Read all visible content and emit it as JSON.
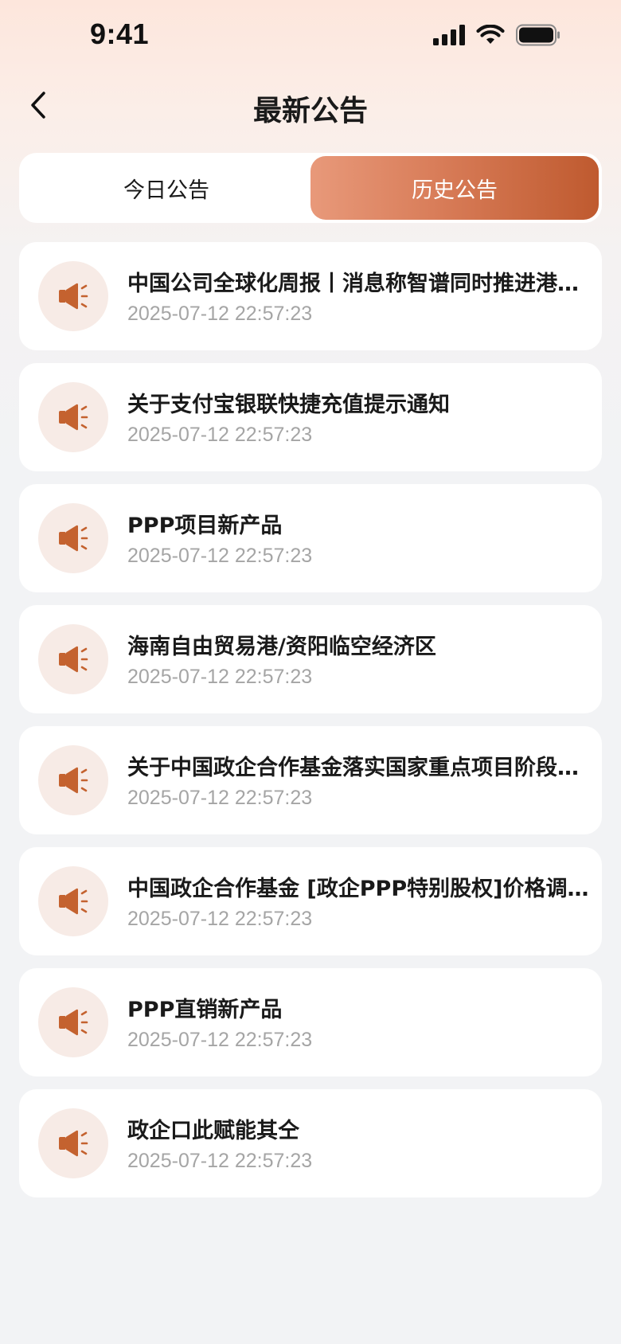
{
  "status_bar": {
    "time": "9:41",
    "icons": [
      "signal-icon",
      "wifi-icon",
      "battery-icon"
    ]
  },
  "header": {
    "title": "最新公告",
    "back_icon": "chevron-left-icon"
  },
  "tabs": [
    {
      "label": "今日公告",
      "active": false
    },
    {
      "label": "历史公告",
      "active": true
    }
  ],
  "colors": {
    "accent": "#c4622f",
    "accent_light": "#e8997a",
    "icon_bg": "#f7ebe6",
    "time_text": "#a5a5a5"
  },
  "announcements": [
    {
      "title": "中国公司全球化周报丨消息称智谱同时推进港股和A股上市",
      "time": "2025-07-12 22:57:23",
      "icon": "megaphone-icon"
    },
    {
      "title": "关于支付宝银联快捷充值提示通知",
      "time": "2025-07-12 22:57:23",
      "icon": "megaphone-icon"
    },
    {
      "title": "PPP项目新产品",
      "time": "2025-07-12 22:57:23",
      "icon": "megaphone-icon"
    },
    {
      "title": "海南自由贸易港/资阳临空经济区",
      "time": "2025-07-12 22:57:23",
      "icon": "megaphone-icon"
    },
    {
      "title": "关于中国政企合作基金落实国家重点项目阶段性成果",
      "time": "2025-07-12 22:57:23",
      "icon": "megaphone-icon"
    },
    {
      "title": "中国政企合作基金 [政企PPP特别股权]价格调整公告",
      "time": "2025-07-12 22:57:23",
      "icon": "megaphone-icon"
    },
    {
      "title": "PPP直销新产品",
      "time": "2025-07-12 22:57:23",
      "icon": "megaphone-icon"
    },
    {
      "title": "政企口此赋能其仝",
      "time": "2025-07-12 22:57:23",
      "icon": "megaphone-icon"
    }
  ]
}
